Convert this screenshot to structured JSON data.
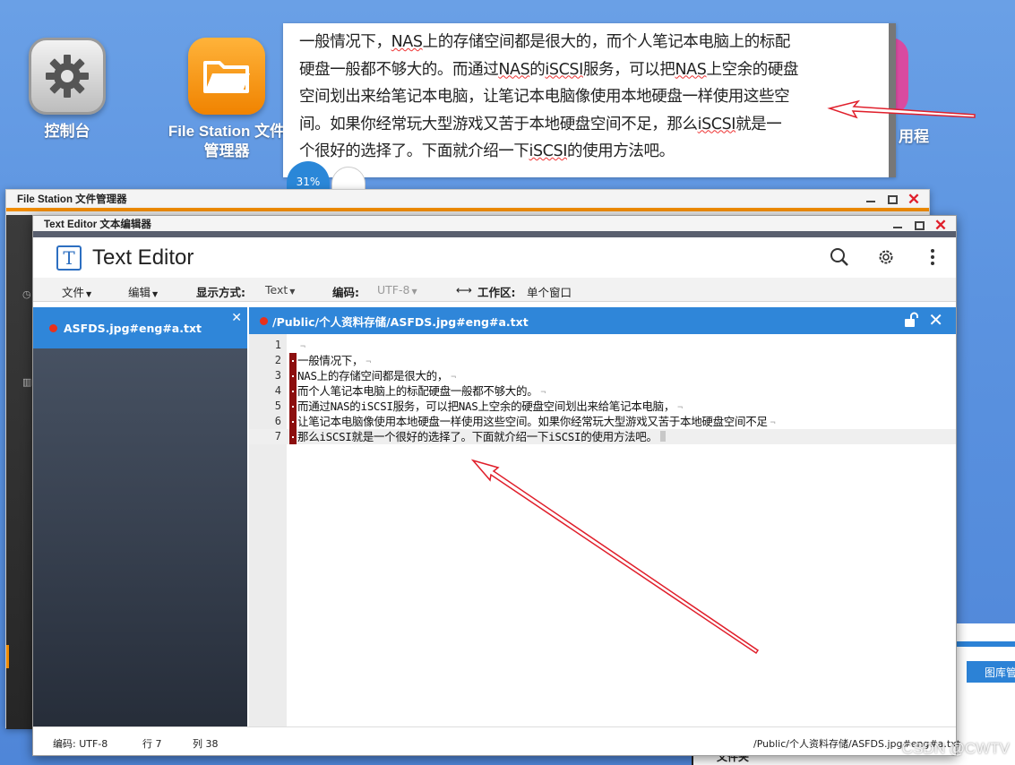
{
  "desktop": {
    "icons": [
      {
        "label": "控制台",
        "icon": "gear-icon"
      },
      {
        "label_line1": "File Station 文件",
        "label_line2": "管理器",
        "icon": "folder-icon"
      }
    ],
    "partial_label": "用程",
    "watermark": "CSDN @CWTV",
    "bg_app_tab": "图库管",
    "bg_app_label": "文件夹"
  },
  "note": {
    "lines": [
      [
        "一般情况下，",
        {
          "s": "NAS"
        },
        "上的存储空间都是很大的，而个人笔记本电脑上的标配"
      ],
      [
        "硬盘一般都不够大的。而通过",
        {
          "s": "NAS"
        },
        "的",
        {
          "s": "iSCSI"
        },
        "服务，可以把",
        {
          "s": "NAS"
        },
        "上空余的硬盘"
      ],
      [
        "空间划出来给笔记本电脑，让笔记本电脑像使用本地硬盘一样使用这些空"
      ],
      [
        "间。如果你经常玩大型游戏又苦于本地硬盘空间不足，那么",
        {
          "s": "iSCSI"
        },
        "就是一"
      ],
      [
        "个很好的选择了。下面就介绍一下",
        {
          "s": "iSCSI"
        },
        "的使用方法吧。"
      ]
    ],
    "badge": "31%"
  },
  "file_station": {
    "title": "File Station 文件管理器"
  },
  "text_editor": {
    "window_title": "Text Editor 文本编辑器",
    "app_title": "Text Editor",
    "logo_letter": "T",
    "menu": {
      "file": "文件",
      "edit": "编辑",
      "display_mode_label": "显示方式:",
      "display_mode_value": "Text",
      "encoding_label": "编码:",
      "encoding_value": "UTF-8",
      "workspace_label": "工作区:",
      "workspace_value": "单个窗口"
    },
    "open_file": "ASFDS.jpg#eng#a.txt",
    "tab_path": "/Public/个人资料存储/ASFDS.jpg#eng#a.txt",
    "lines": [
      {
        "n": "1",
        "text": ""
      },
      {
        "n": "2",
        "text": "一般情况下，"
      },
      {
        "n": "3",
        "text": "NAS上的存储空间都是很大的，"
      },
      {
        "n": "4",
        "text": "而个人笔记本电脑上的标配硬盘一般都不够大的。"
      },
      {
        "n": "5",
        "text": "而通过NAS的iSCSI服务，可以把NAS上空余的硬盘空间划出来给笔记本电脑，"
      },
      {
        "n": "6",
        "text": "让笔记本电脑像使用本地硬盘一样使用这些空间。如果你经常玩大型游戏又苦于本地硬盘空间不足"
      },
      {
        "n": "7",
        "text": "那么iSCSI就是一个很好的选择了。下面就介绍一下iSCSI的使用方法吧。"
      }
    ],
    "status": {
      "encoding": "编码:  UTF-8",
      "row": "行 7",
      "col": "列 38",
      "path": "/Public/个人资料存储/ASFDS.jpg#eng#a.txt"
    }
  },
  "colors": {
    "accent": "#2f86d9",
    "file_station_accent": "#f08c00",
    "annotation": "#e01f2b",
    "marker": "#8c0f0f"
  }
}
